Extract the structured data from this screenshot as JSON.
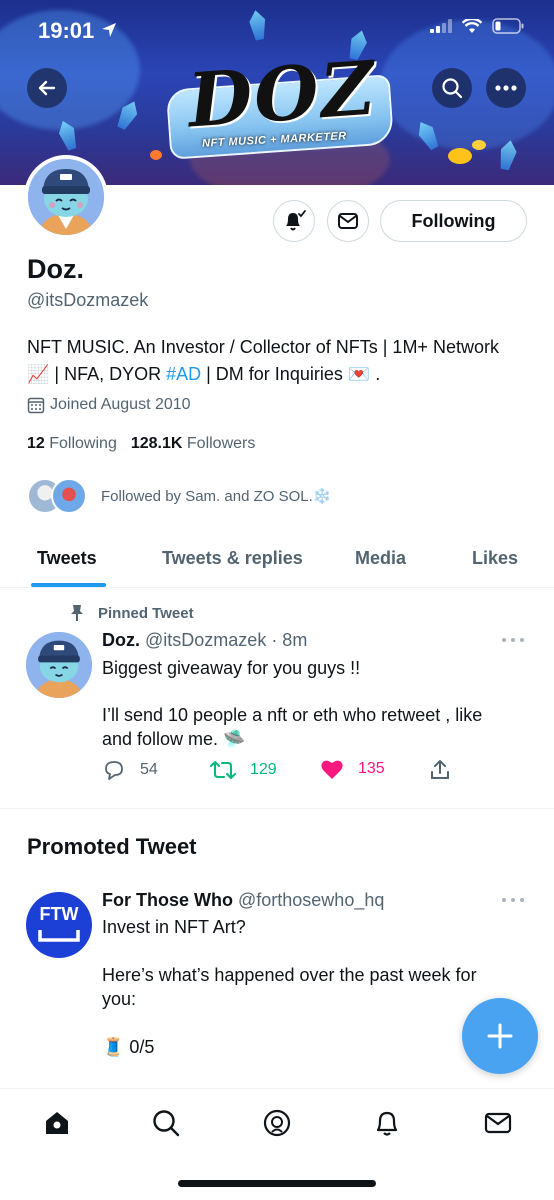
{
  "status_bar": {
    "time": "19:01"
  },
  "banner": {
    "logo_text": "DOZ",
    "logo_subtext": "NFT MUSIC + MARKETER"
  },
  "profile": {
    "name": "Doz.",
    "handle": "@itsDozmazek",
    "bio_line1": "NFT MUSIC. An Investor / Collector of NFTs | 1M+ Network",
    "bio_line2_a": "📈 | NFA, DYOR ",
    "bio_hashtag": "#AD",
    "bio_line2_b": " | DM for Inquiries 💌 .",
    "joined": "Joined August 2010",
    "following_count": "12",
    "following_label": "Following",
    "followers_count": "128.1K",
    "followers_label": "Followers",
    "followed_by": "Followed by Sam. and ZO SOL.❄️",
    "following_button": "Following"
  },
  "tabs": [
    {
      "label": "Tweets",
      "active": true
    },
    {
      "label": "Tweets & replies",
      "active": false
    },
    {
      "label": "Media",
      "active": false
    },
    {
      "label": "Likes",
      "active": false
    }
  ],
  "pinned_tweet": {
    "pinned_label": "Pinned Tweet",
    "name": "Doz.",
    "meta": "@itsDozmazek · 8m",
    "text_line1": "Biggest giveaway for you guys !!",
    "text_line2": "I’ll send 10 people a nft or eth who retweet , like and follow me. 🛸",
    "replies": "54",
    "retweets": "129",
    "likes": "135"
  },
  "promoted": {
    "header": "Promoted Tweet",
    "name": "For Those Who",
    "handle": "@forthosewho_hq",
    "avatar_text": "FTW",
    "text_line1": "Invest in NFT Art?",
    "text_line2": "Here’s what’s happened over the past week for you:",
    "text_line3": "🧵 0/5"
  },
  "colors": {
    "accent": "#1d9bf0",
    "like": "#f91880",
    "retweet": "#00ba7c",
    "fab": "#4aa3f0"
  },
  "bottom_nav": [
    "home-icon",
    "search-icon",
    "spaces-icon",
    "notifications-icon",
    "messages-icon"
  ]
}
